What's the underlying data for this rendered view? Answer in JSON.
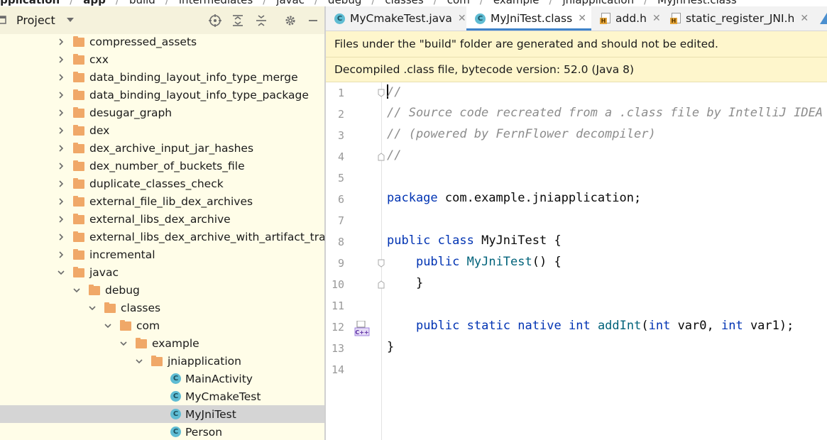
{
  "breadcrumb": [
    "application",
    "app",
    "build",
    "intermediates",
    "javac",
    "debug",
    "classes",
    "com",
    "example",
    "jniapplication",
    "MyJniTest.class"
  ],
  "project_panel": {
    "title": "Project",
    "tree": [
      {
        "label": "compressed_assets",
        "type": "folder",
        "expanded": false,
        "depth": 0
      },
      {
        "label": "cxx",
        "type": "folder",
        "expanded": false,
        "depth": 0
      },
      {
        "label": "data_binding_layout_info_type_merge",
        "type": "folder",
        "expanded": false,
        "depth": 0
      },
      {
        "label": "data_binding_layout_info_type_package",
        "type": "folder",
        "expanded": false,
        "depth": 0
      },
      {
        "label": "desugar_graph",
        "type": "folder",
        "expanded": false,
        "depth": 0
      },
      {
        "label": "dex",
        "type": "folder",
        "expanded": false,
        "depth": 0
      },
      {
        "label": "dex_archive_input_jar_hashes",
        "type": "folder",
        "expanded": false,
        "depth": 0
      },
      {
        "label": "dex_number_of_buckets_file",
        "type": "folder",
        "expanded": false,
        "depth": 0
      },
      {
        "label": "duplicate_classes_check",
        "type": "folder",
        "expanded": false,
        "depth": 0
      },
      {
        "label": "external_file_lib_dex_archives",
        "type": "folder",
        "expanded": false,
        "depth": 0
      },
      {
        "label": "external_libs_dex_archive",
        "type": "folder",
        "expanded": false,
        "depth": 0
      },
      {
        "label": "external_libs_dex_archive_with_artifact_transforms",
        "type": "folder",
        "expanded": false,
        "depth": 0
      },
      {
        "label": "incremental",
        "type": "folder",
        "expanded": false,
        "depth": 0
      },
      {
        "label": "javac",
        "type": "folder",
        "expanded": true,
        "depth": 0
      },
      {
        "label": "debug",
        "type": "folder",
        "expanded": true,
        "depth": 1
      },
      {
        "label": "classes",
        "type": "folder",
        "expanded": true,
        "depth": 2
      },
      {
        "label": "com",
        "type": "folder",
        "expanded": true,
        "depth": 3
      },
      {
        "label": "example",
        "type": "folder",
        "expanded": true,
        "depth": 4
      },
      {
        "label": "jniapplication",
        "type": "folder",
        "expanded": true,
        "depth": 5
      },
      {
        "label": "MainActivity",
        "type": "class",
        "depth": 6
      },
      {
        "label": "MyCmakeTest",
        "type": "class",
        "depth": 6
      },
      {
        "label": "MyJniTest",
        "type": "class",
        "depth": 6,
        "selected": true
      },
      {
        "label": "Person",
        "type": "class",
        "depth": 6
      }
    ]
  },
  "tabs": [
    {
      "label": "MyCmakeTest.java",
      "icon": "class-icon",
      "active": false
    },
    {
      "label": "MyJniTest.class",
      "icon": "class-icon",
      "active": true
    },
    {
      "label": "add.h",
      "icon": "header-file-icon",
      "active": false
    },
    {
      "label": "static_register_JNI.h",
      "icon": "header-file-icon",
      "active": false
    }
  ],
  "notices": {
    "generated": "Files under the \"build\" folder are generated and should not be edited.",
    "decompiled": "Decompiled .class file, bytecode version: 52.0 (Java 8)"
  },
  "code_lines": [
    "//",
    "// Source code recreated from a .class file by IntelliJ IDEA",
    "// (powered by FernFlower decompiler)",
    "//",
    "",
    "package com.example.jniapplication;",
    "",
    "public class MyJniTest {",
    "    public MyJniTest() {",
    "    }",
    "",
    "    public static native int addInt(int var0, int var1);",
    "}",
    ""
  ],
  "gutter_marker": "C++",
  "colors": {
    "project_bg": "#fffde8",
    "selected_row": "#d5d5d5",
    "notice_bg": "#fef6cc",
    "keyword": "#0033b3",
    "method": "#00627a",
    "comment": "#8c8c8c",
    "active_tab_underline": "#4083c9",
    "folder": "#f0a868",
    "class_icon": "#5fbcd3"
  }
}
